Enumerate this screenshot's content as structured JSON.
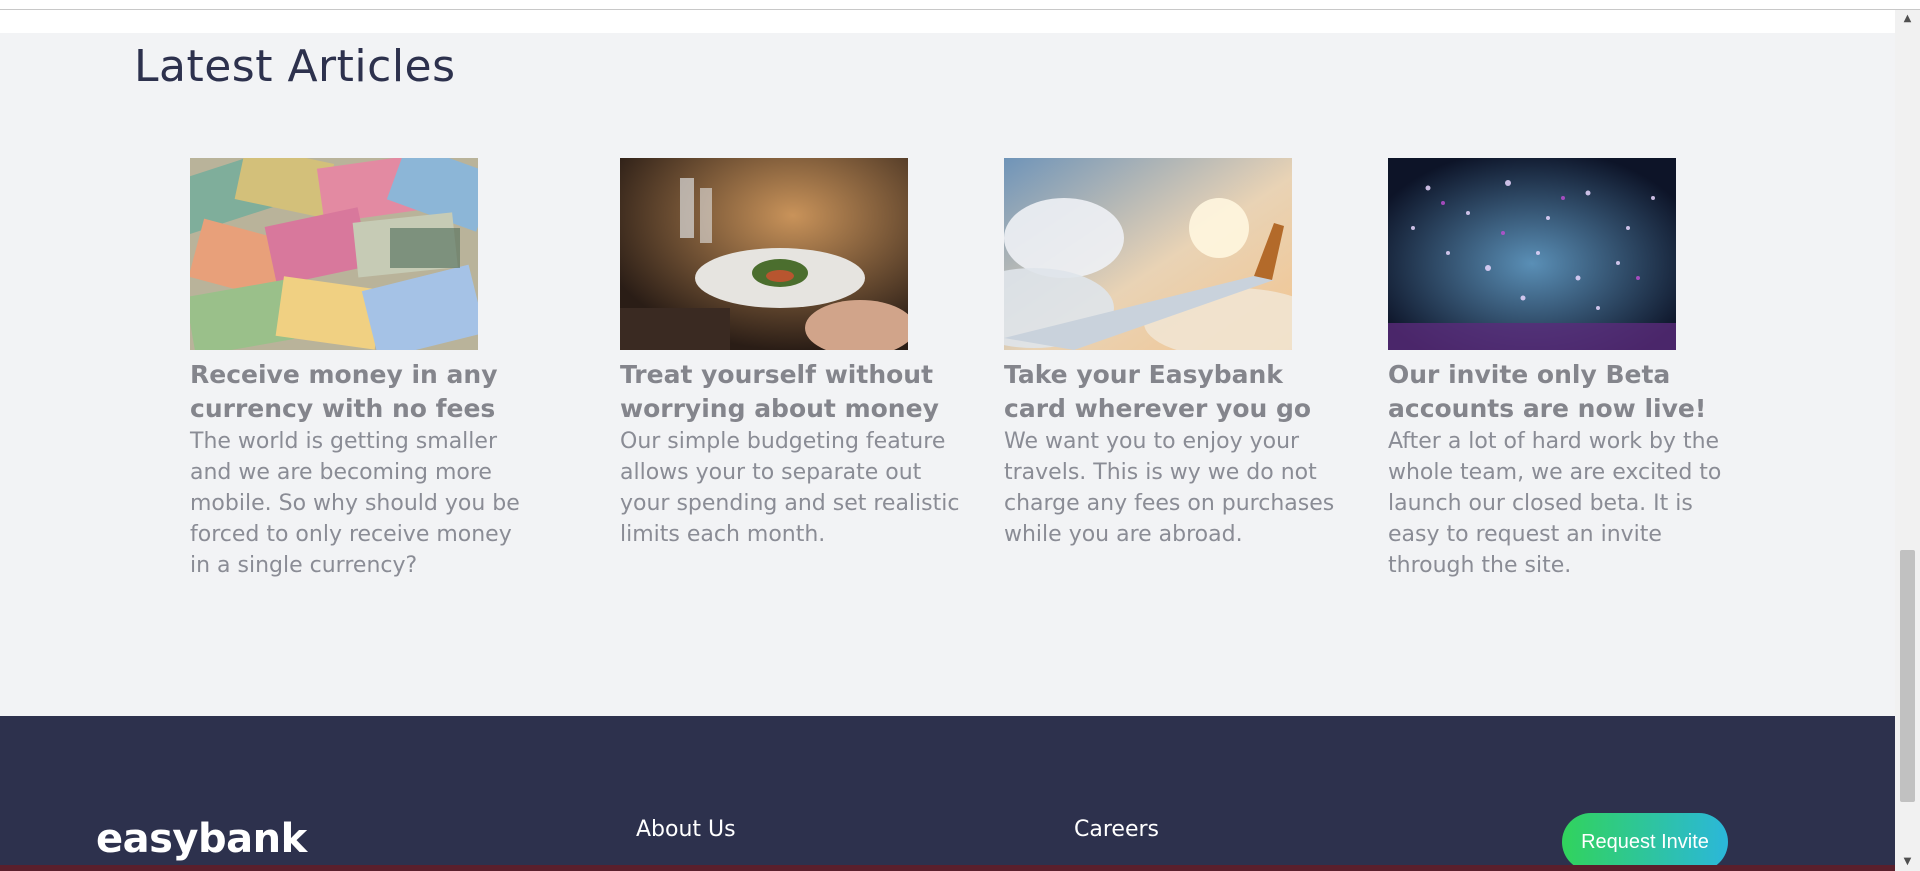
{
  "articles": {
    "heading": "Latest Articles",
    "items": [
      {
        "title": "Receive money in any currency with no fees",
        "excerpt": "The world is getting smaller and we are becoming more mobile. So why should you be forced to only receive money in a single currency?",
        "image_icon": "currency-photo"
      },
      {
        "title": "Treat yourself without worrying about money",
        "excerpt": "Our simple budgeting feature allows your to separate out your spending and set realistic limits each month.",
        "image_icon": "restaurant-photo"
      },
      {
        "title": "Take your Easybank card wherever you go",
        "excerpt": "We want you to enjoy your travels. This is wy we do not charge any fees on purchases while you are abroad.",
        "image_icon": "plane-photo"
      },
      {
        "title": "Our invite only Beta accounts are now live!",
        "excerpt": "After a lot of hard work by the whole team, we are excited to launch our closed beta. It is easy to request an invite through the site.",
        "image_icon": "confetti-photo"
      }
    ]
  },
  "footer": {
    "brand": "easybank",
    "links": [
      "About Us",
      "Careers"
    ],
    "cta_label": "Request Invite"
  },
  "colors": {
    "section_bg": "#f2f3f5",
    "footer_bg": "#2d314d",
    "heading": "#2d314d",
    "cta_gradient_start": "#31d35c",
    "cta_gradient_end": "#2bb7da"
  }
}
